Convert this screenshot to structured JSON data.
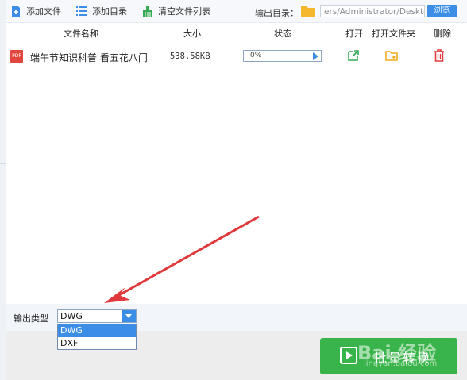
{
  "toolbar": {
    "add_file": "添加文件",
    "add_folder": "添加目录",
    "clear_list": "清空文件列表",
    "output_dir_label": "输出目录：",
    "output_dir_value": "ers/Administrator/Desktop",
    "browse": "浏览"
  },
  "table": {
    "headers": {
      "name": "文件名称",
      "size": "大小",
      "status": "状态",
      "open": "打开",
      "open_folder": "打开文件夹",
      "delete": "删除"
    },
    "rows": [
      {
        "icon_text": "PDF",
        "name": "端午节知识科普 看五花八门",
        "size": "538.58KB",
        "progress_text": "0%",
        "progress": 0
      }
    ]
  },
  "output": {
    "type_label": "输出类型",
    "selected": "DWG",
    "options": [
      "DWG",
      "DXF"
    ]
  },
  "convert_button": "批量转换",
  "watermark": {
    "main": "Bai  经验",
    "sub": "jingyan.baidu.com"
  },
  "colors": {
    "accent": "#3b8de6",
    "convert": "#39b44a",
    "annotation_arrow": "#e0383b"
  }
}
